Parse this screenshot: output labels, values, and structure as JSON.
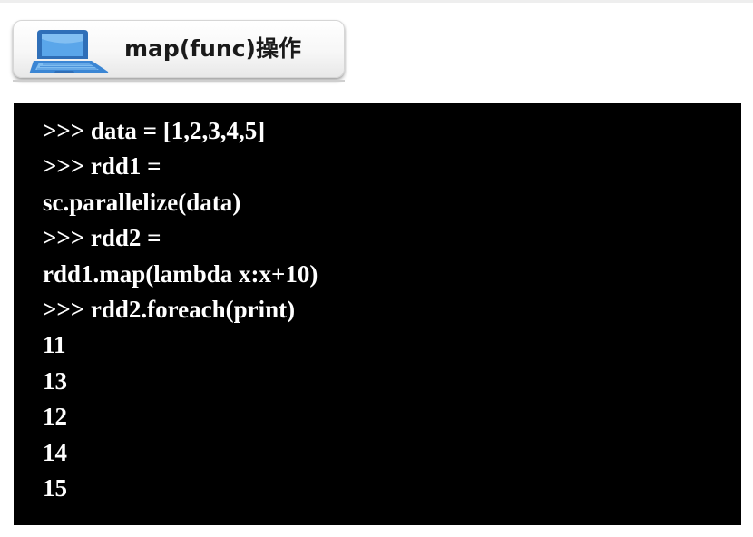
{
  "header": {
    "title": "map(func)操作",
    "icon": "laptop-icon",
    "icon_color": "#3b86d4"
  },
  "terminal": {
    "background": "#000000",
    "text_color": "#ffffff",
    "lines": [
      ">>> data = [1,2,3,4,5]",
      ">>> rdd1 =",
      "sc.parallelize(data)",
      ">>> rdd2 =",
      "rdd1.map(lambda x:x+10)",
      ">>> rdd2.foreach(print)",
      "11",
      "13",
      "12",
      "14",
      "15"
    ]
  }
}
